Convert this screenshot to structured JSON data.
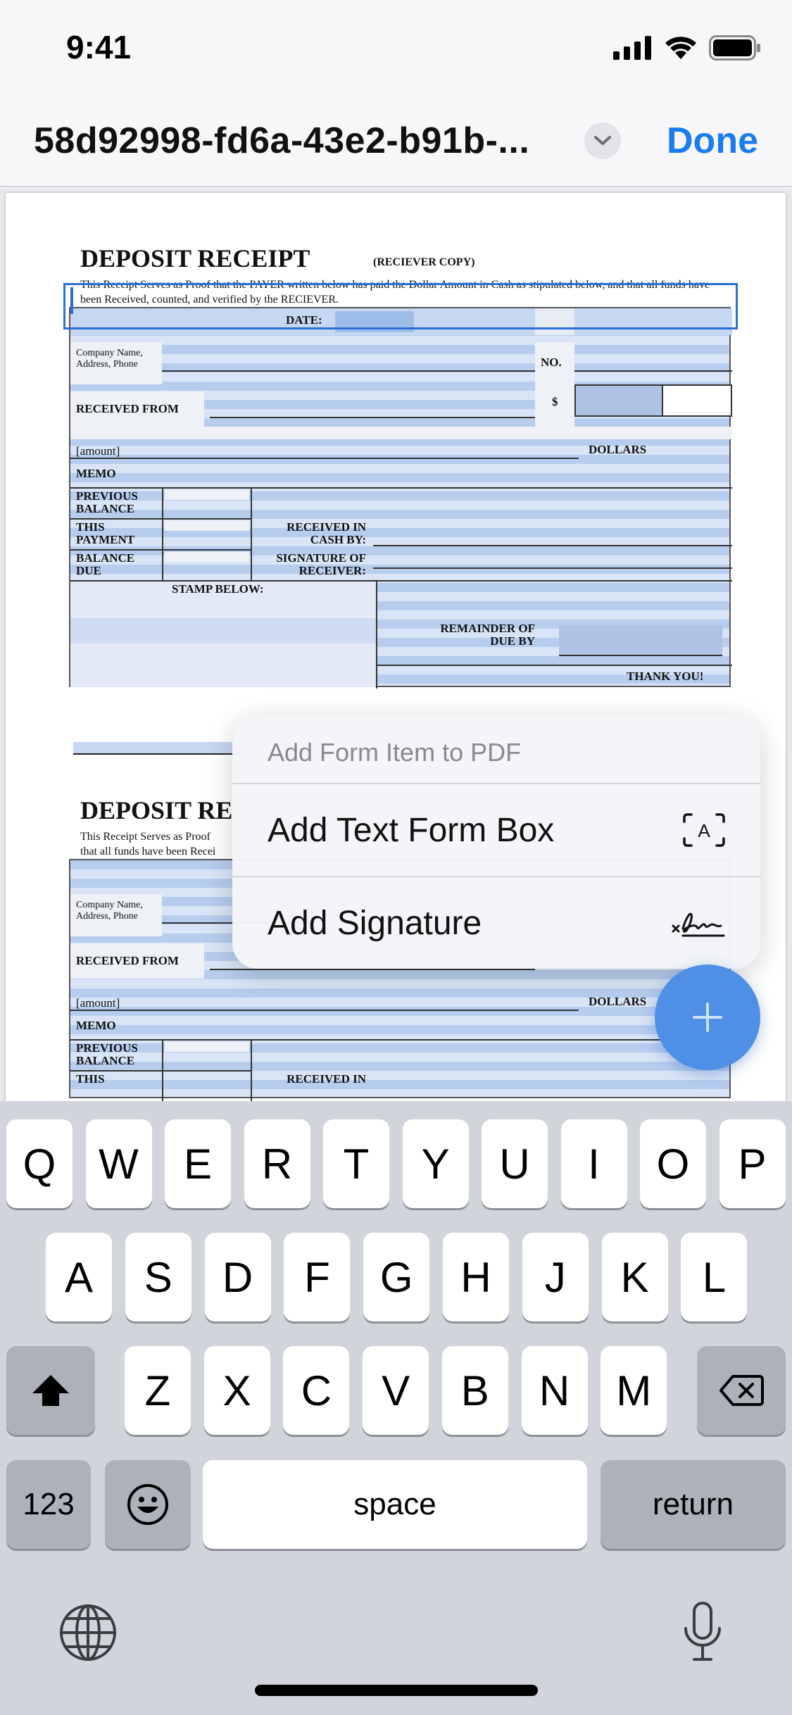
{
  "status_bar": {
    "time": "9:41"
  },
  "nav": {
    "title": "58d92998-fd6a-43e2-b91b-...",
    "done_label": "Done"
  },
  "receipt": {
    "title": "DEPOSIT RECEIPT",
    "subtitle": "(RECIEVER COPY)",
    "description": "This Receipt Serves as Proof that the PAYER written below has paid the Dollar Amount in Cash as stipulated below, and that all funds have been Received, counted, and verified by the RECIEVER.",
    "date_label": "DATE:",
    "company_label": "Company Name,\nAddress, Phone",
    "no_label": "NO.",
    "received_from_label": "RECEIVED FROM",
    "dollar_sign": "$",
    "amount_label": "[amount]",
    "dollars_label": "DOLLARS",
    "memo_label": "MEMO",
    "previous_balance_label": "PREVIOUS\nBALANCE",
    "this_payment_label": "THIS\nPAYMENT",
    "balance_due_label": "BALANCE\nDUE",
    "received_in_cash_label": "RECEIVED IN\nCASH BY:",
    "signature_label": "SIGNATURE OF\nRECEIVER:",
    "stamp_label": "STAMP BELOW:",
    "remainder_label": "REMAINDER OF\nDUE BY",
    "thank_you_label": "THANK YOU!",
    "second_title": "DEPOSIT RE",
    "second_desc_line1": "This Receipt Serves as Proof",
    "second_desc_line2": "that all funds have been Recei",
    "second_this_label": "THIS",
    "second_received_in_label": "RECEIVED IN"
  },
  "popover": {
    "header": "Add Form Item to PDF",
    "items": [
      {
        "label": "Add Text Form Box",
        "icon": "text-form-box-icon"
      },
      {
        "label": "Add Signature",
        "icon": "signature-icon"
      }
    ]
  },
  "keyboard": {
    "row1": [
      "Q",
      "W",
      "E",
      "R",
      "T",
      "Y",
      "U",
      "I",
      "O",
      "P"
    ],
    "row2": [
      "A",
      "S",
      "D",
      "F",
      "G",
      "H",
      "J",
      "K",
      "L"
    ],
    "row3": [
      "Z",
      "X",
      "C",
      "V",
      "B",
      "N",
      "M"
    ],
    "numbers_label": "123",
    "space_label": "space",
    "return_label": "return"
  },
  "colors": {
    "accent": "#1a7cf2",
    "form_fill": "#b7cdee",
    "fab": "#4f8fe6",
    "keyboard_bg": "#d1d4db"
  }
}
